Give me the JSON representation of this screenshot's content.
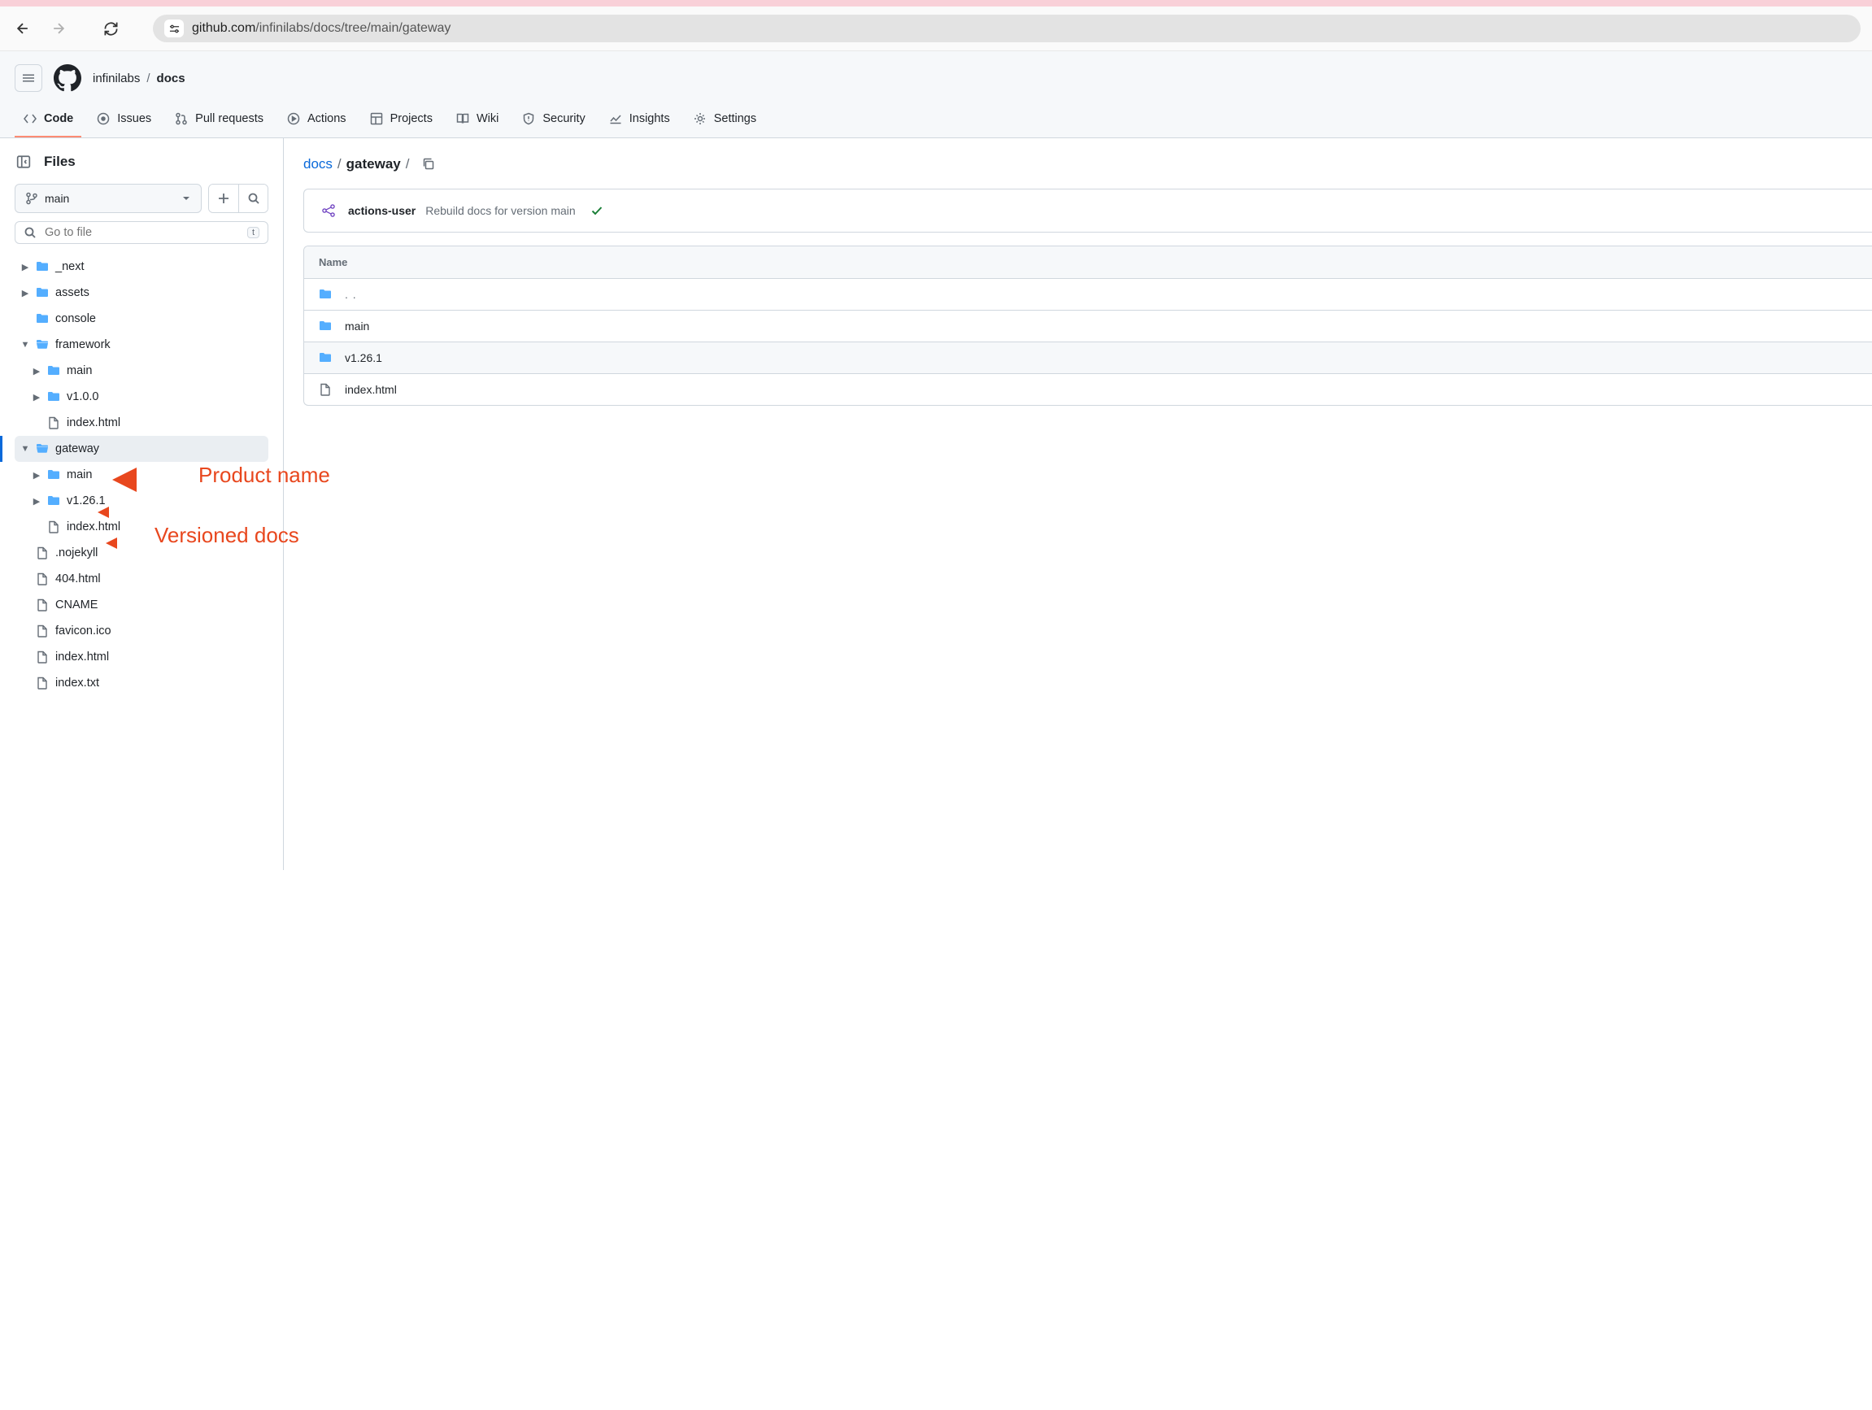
{
  "browser": {
    "url_host": "github.com",
    "url_path": "/infinilabs/docs/tree/main/gateway"
  },
  "repo": {
    "owner": "infinilabs",
    "name": "docs"
  },
  "tabs": {
    "code": "Code",
    "issues": "Issues",
    "pulls": "Pull requests",
    "actions": "Actions",
    "projects": "Projects",
    "wiki": "Wiki",
    "security": "Security",
    "insights": "Insights",
    "settings": "Settings"
  },
  "sidebar": {
    "title": "Files",
    "branch": "main",
    "filter_placeholder": "Go to file",
    "kbd": "t",
    "tree": {
      "next": "_next",
      "assets": "assets",
      "console": "console",
      "framework": "framework",
      "framework_main": "main",
      "framework_v100": "v1.0.0",
      "framework_index": "index.html",
      "gateway": "gateway",
      "gateway_main": "main",
      "gateway_v1261": "v1.26.1",
      "gateway_index": "index.html",
      "nojekyll": ".nojekyll",
      "f404": "404.html",
      "cname": "CNAME",
      "favicon": "favicon.ico",
      "indexhtml": "index.html",
      "indextxt": "index.txt"
    }
  },
  "breadcrumb": {
    "root": "docs",
    "current": "gateway"
  },
  "commit": {
    "author": "actions-user",
    "message": "Rebuild docs for version main"
  },
  "table": {
    "header": "Name",
    "parent": ". .",
    "rows": {
      "main": "main",
      "v1261": "v1.26.1",
      "indexhtml": "index.html"
    }
  },
  "annotations": {
    "product_name": "Product name",
    "versioned_docs": "Versioned docs"
  }
}
